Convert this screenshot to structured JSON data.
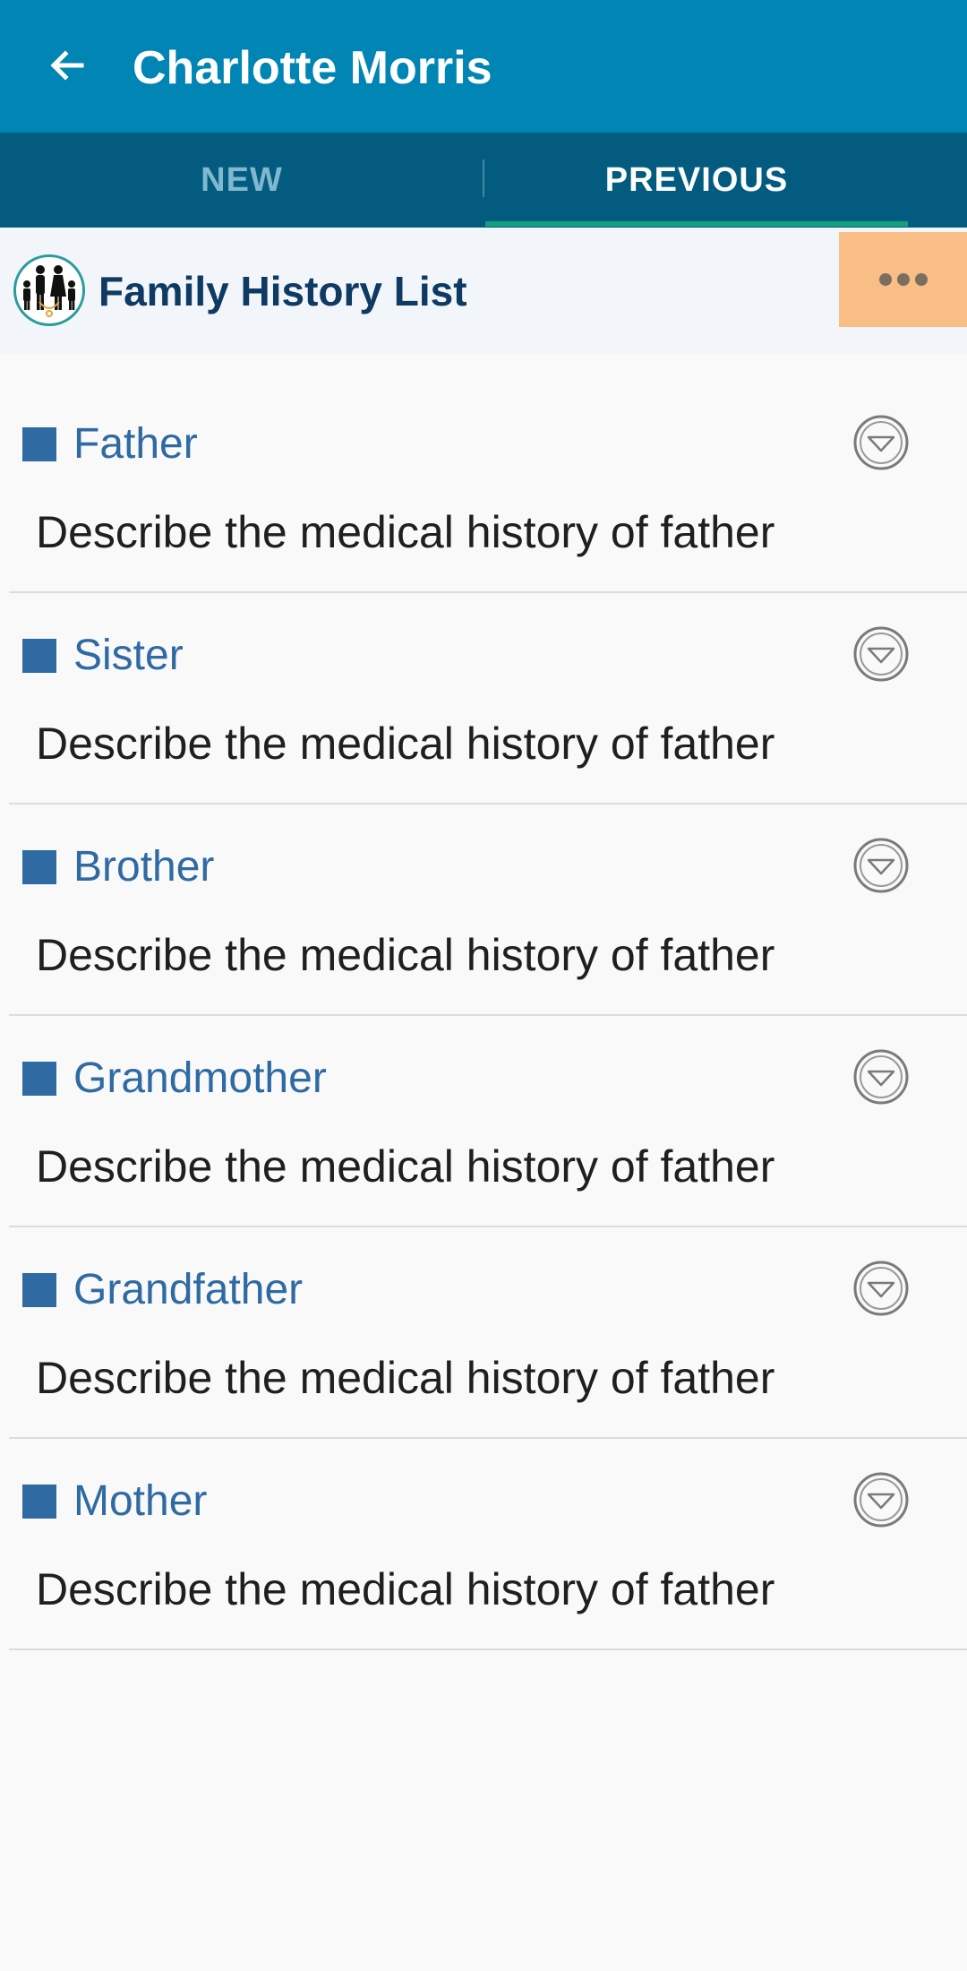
{
  "app_bar": {
    "title": "Charlotte Morris",
    "back_icon": "arrow-left-icon",
    "background": "#0085b4"
  },
  "tabs": [
    {
      "label": "NEW",
      "active": false
    },
    {
      "label": "PREVIOUS",
      "active": true
    }
  ],
  "section": {
    "title": "Family History List",
    "logo_icon": "family-icon",
    "more_icon": "more-horizontal-icon",
    "more_button_color": "#f9bd86"
  },
  "items": [
    {
      "relation": "Father",
      "description": "Describe the medical history of father",
      "icon": "chevron-down-circle-icon"
    },
    {
      "relation": "Sister",
      "description": "Describe the medical history of father",
      "icon": "chevron-down-circle-icon"
    },
    {
      "relation": "Brother",
      "description": "Describe the medical history of father",
      "icon": "chevron-down-circle-icon"
    },
    {
      "relation": "Grandmother",
      "description": "Describe the medical history of father",
      "icon": "chevron-down-circle-icon"
    },
    {
      "relation": "Grandfather",
      "description": "Describe the medical history of father",
      "icon": "chevron-down-circle-icon"
    },
    {
      "relation": "Mother",
      "description": "Describe the medical history of father",
      "icon": "chevron-down-circle-icon"
    }
  ],
  "colors": {
    "tab_bar": "#035c80",
    "tab_indicator": "#13a07e",
    "accent": "#2f6aa3",
    "section_title": "#0f3a63"
  }
}
